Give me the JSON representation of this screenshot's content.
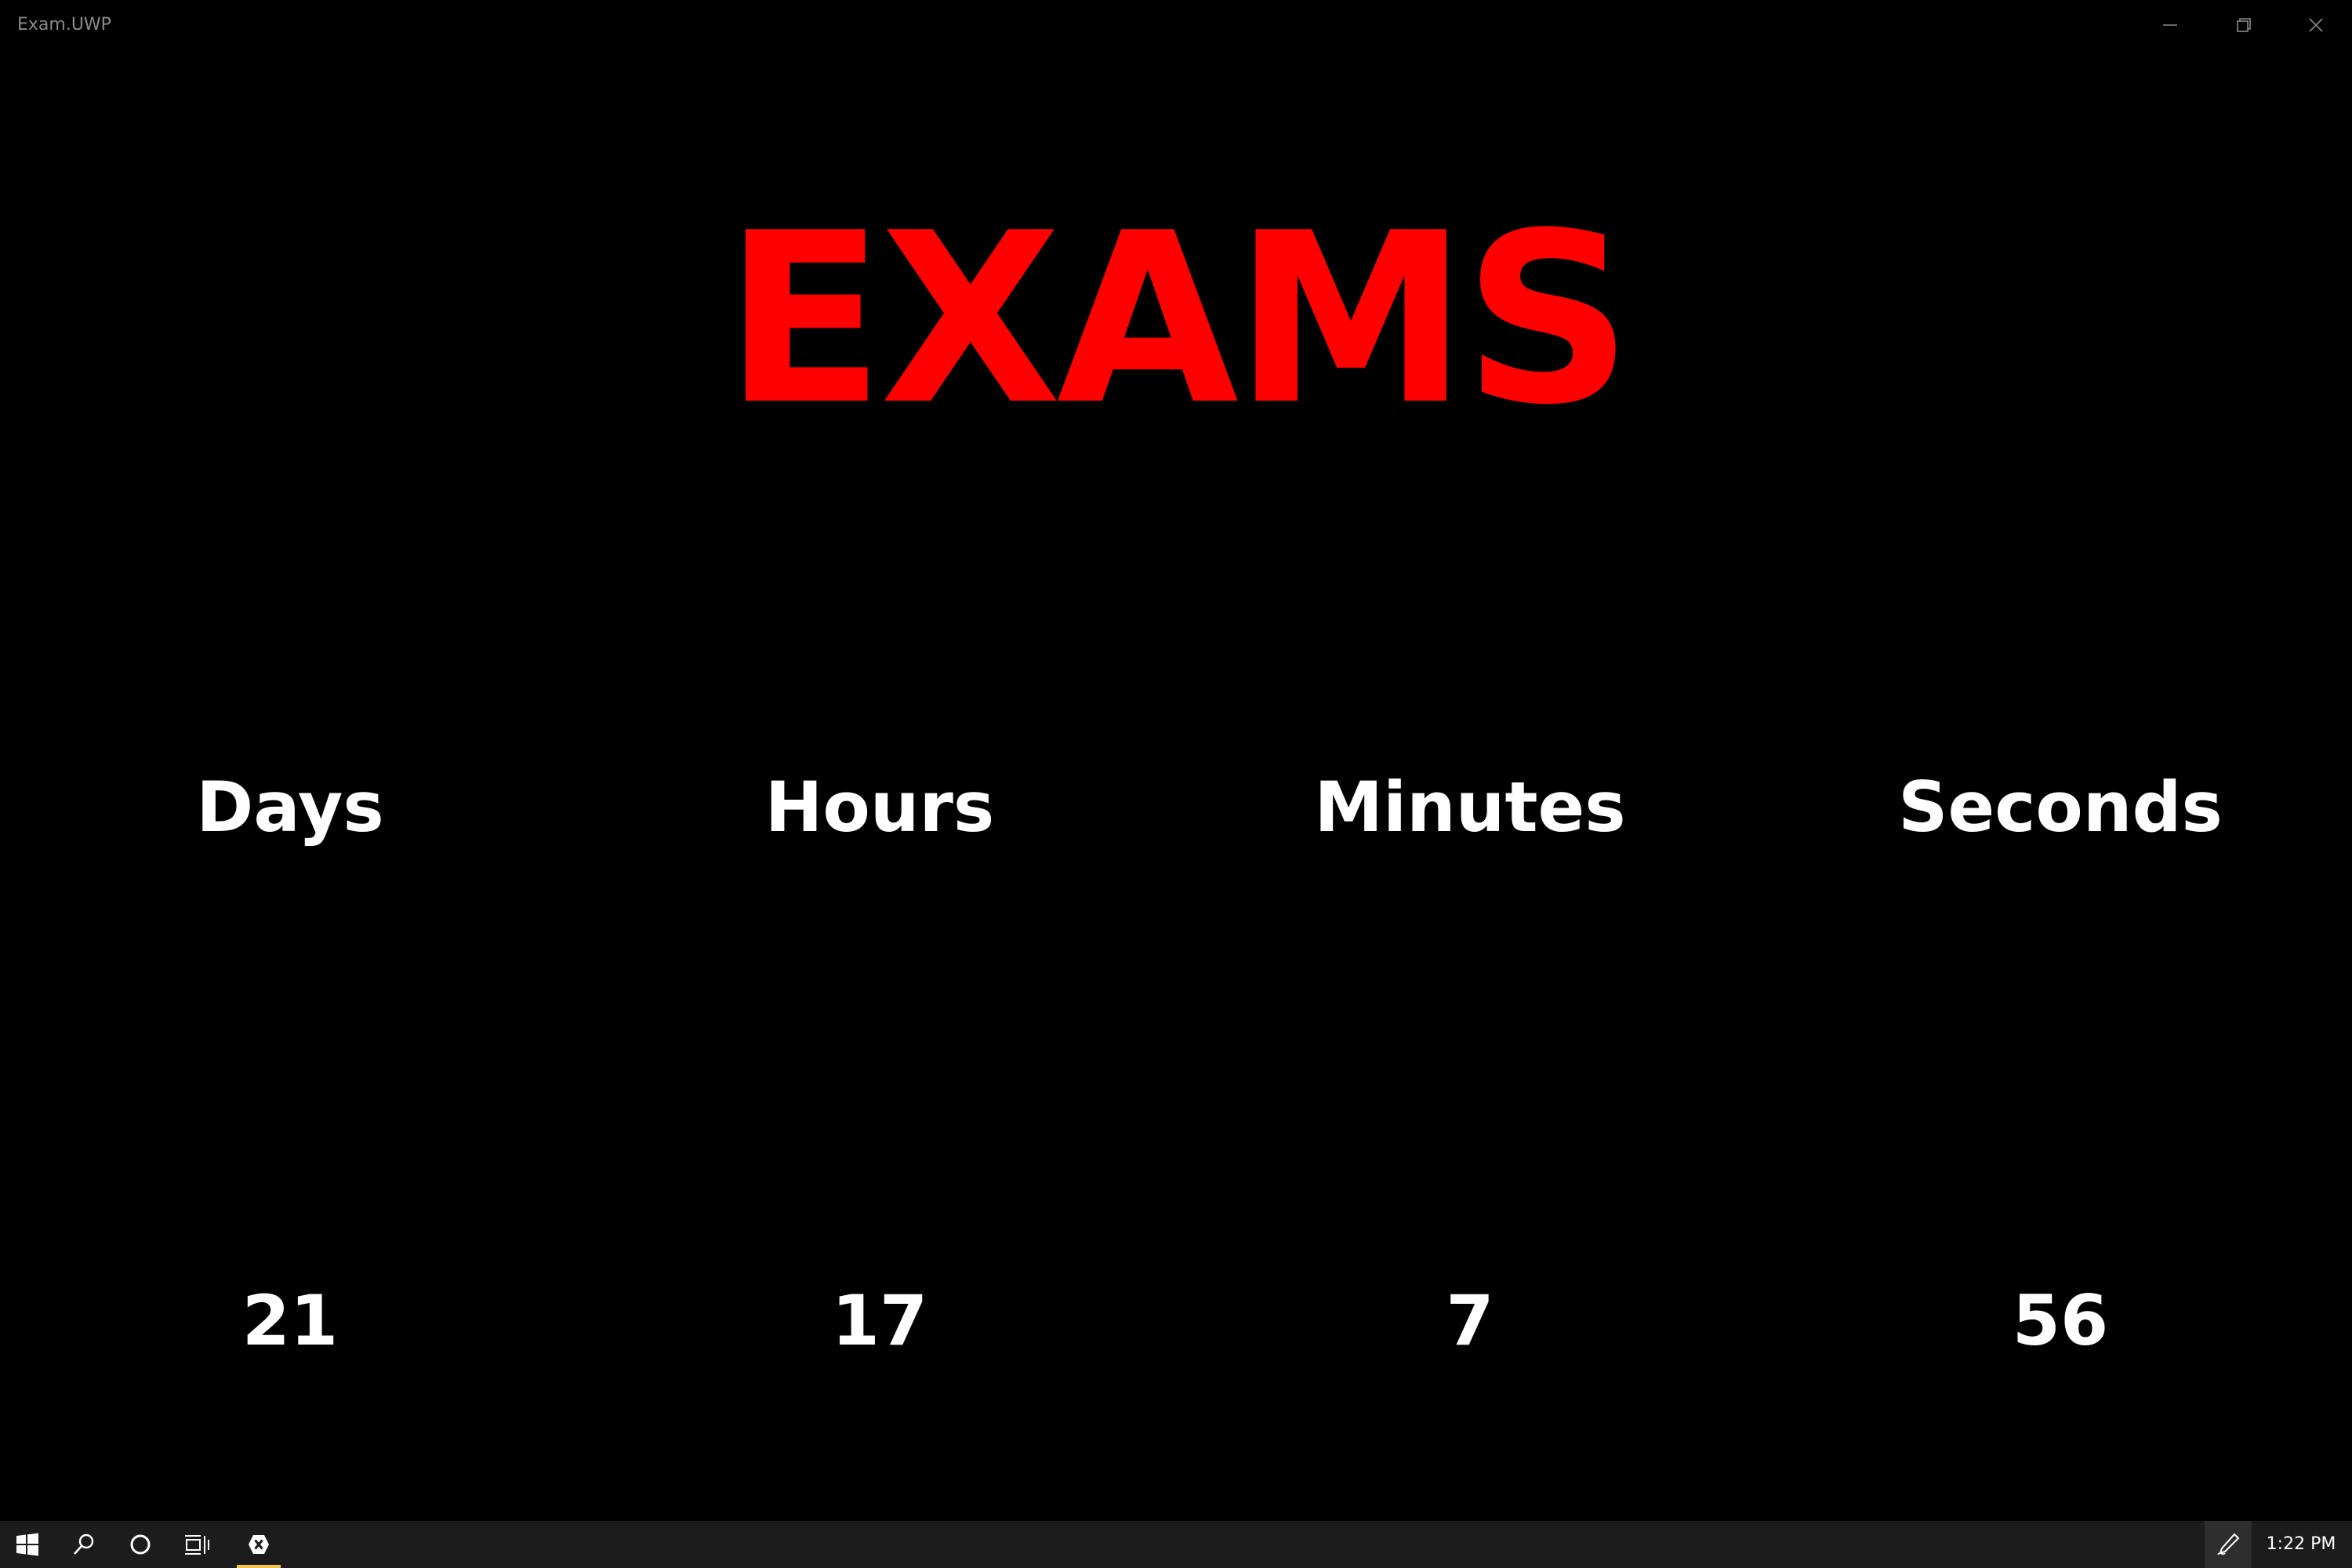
{
  "window": {
    "title": "Exam.UWP"
  },
  "headline": "EXAMS",
  "countdown": {
    "labels": [
      "Days",
      "Hours",
      "Minutes",
      "Seconds"
    ],
    "values": [
      "21",
      "17",
      "7",
      "56"
    ]
  },
  "taskbar": {
    "clock": "1:22 PM",
    "icons": [
      "windows-start-icon",
      "search-icon",
      "cortana-icon",
      "task-view-icon",
      "xamarin-app-icon",
      "pen-workspace-icon"
    ]
  },
  "colors": {
    "background": "#000000",
    "headline": "#ff0000",
    "text": "#ffffff",
    "taskbar": "#1c1c1c",
    "running_indicator": "#f2c74b"
  }
}
